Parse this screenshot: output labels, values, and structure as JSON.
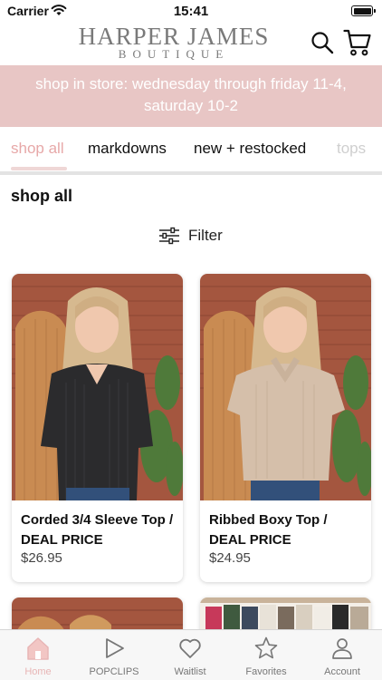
{
  "status_bar": {
    "carrier": "Carrier",
    "time": "15:41"
  },
  "header": {
    "logo_main": "HARPER JAMES",
    "logo_sub": "BOUTIQUE"
  },
  "promo": {
    "text": "shop in store: wednesday through friday 11-4, saturday 10-2"
  },
  "category_tabs": [
    {
      "label": "shop all",
      "active": true
    },
    {
      "label": "markdowns",
      "active": false
    },
    {
      "label": "new + restocked",
      "active": false
    },
    {
      "label": "tops",
      "active": false
    }
  ],
  "section": {
    "title": "shop all",
    "filter_label": "Filter"
  },
  "products": [
    {
      "name": "Corded 3/4 Sleeve Top / DEAL PRICE",
      "price": "$26.95"
    },
    {
      "name": "Ribbed Boxy Top / DEAL PRICE",
      "price": "$24.95"
    }
  ],
  "tab_bar": [
    {
      "label": "Home",
      "icon": "home-icon",
      "active": true
    },
    {
      "label": "POPCLIPS",
      "icon": "play-icon",
      "active": false
    },
    {
      "label": "Waitlist",
      "icon": "heart-icon",
      "active": false
    },
    {
      "label": "Favorites",
      "icon": "star-icon",
      "active": false
    },
    {
      "label": "Account",
      "icon": "person-icon",
      "active": false
    }
  ],
  "colors": {
    "brand_pink": "#e8c6c5",
    "active_tab": "#e7a8a8",
    "logo_gray": "#7a7a7a",
    "top_black": "#2b2b2d",
    "top_tan": "#d5bfaa"
  }
}
